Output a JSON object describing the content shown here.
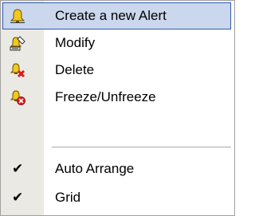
{
  "menu": {
    "items": [
      {
        "label": "Create a new Alert",
        "icon": "bell-icon",
        "highlighted": true
      },
      {
        "label": "Modify",
        "icon": "bell-edit-icon"
      },
      {
        "label": "Delete",
        "icon": "bell-delete-icon"
      },
      {
        "label": "Freeze/Unfreeze",
        "icon": "bell-freeze-icon"
      }
    ],
    "toggles": [
      {
        "label": "Auto Arrange",
        "checked": true,
        "check_glyph": "✔"
      },
      {
        "label": "Grid",
        "checked": true,
        "check_glyph": "✔"
      }
    ]
  },
  "colors": {
    "highlight_bg": "#cbd7ec",
    "highlight_border": "#305ab0",
    "gutter": "#ebe9e3",
    "bell": "#f2c81e",
    "delete_red": "#e01818"
  }
}
